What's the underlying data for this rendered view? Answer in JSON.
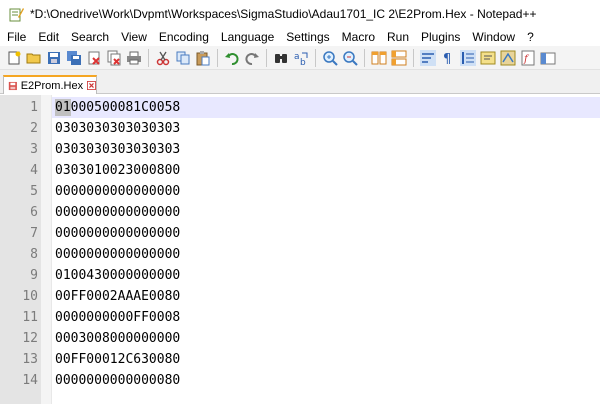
{
  "window": {
    "title": "*D:\\Onedrive\\Work\\Dvpmt\\Workspaces\\SigmaStudio\\Adau1701_IC 2\\E2Prom.Hex - Notepad++"
  },
  "menu": [
    "File",
    "Edit",
    "Search",
    "View",
    "Encoding",
    "Language",
    "Settings",
    "Macro",
    "Run",
    "Plugins",
    "Window",
    "?"
  ],
  "tab": {
    "label": "E2Prom.Hex"
  },
  "editor": {
    "lines": [
      {
        "num": "1",
        "text": "01000500081C0058"
      },
      {
        "num": "2",
        "text": "0303030303030303"
      },
      {
        "num": "3",
        "text": "0303030303030303"
      },
      {
        "num": "4",
        "text": "0303010023000800"
      },
      {
        "num": "5",
        "text": "0000000000000000"
      },
      {
        "num": "6",
        "text": "0000000000000000"
      },
      {
        "num": "7",
        "text": "0000000000000000"
      },
      {
        "num": "8",
        "text": "0000000000000000"
      },
      {
        "num": "9",
        "text": "0100430000000000"
      },
      {
        "num": "10",
        "text": "00FF0002AAAE0080"
      },
      {
        "num": "11",
        "text": "0000000000FF0008"
      },
      {
        "num": "12",
        "text": "0003008000000000"
      },
      {
        "num": "13",
        "text": "00FF00012C630080"
      },
      {
        "num": "14",
        "text": "0000000000000080"
      }
    ]
  },
  "colors": {
    "tab_accent": "#f5a623",
    "gutter_bg": "#e4e4e4",
    "current_line": "#e8e8ff"
  }
}
